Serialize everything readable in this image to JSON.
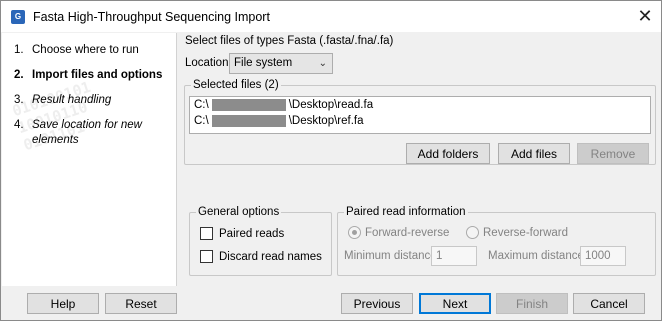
{
  "window": {
    "title": "Fasta High-Throughput Sequencing Import",
    "icon": "clc-app-icon",
    "icon_text": "G"
  },
  "sidebar": {
    "steps": [
      {
        "num": "1.",
        "label": "Choose where to run"
      },
      {
        "num": "2.",
        "label": "Import files and options"
      },
      {
        "num": "3.",
        "label": "Result handling"
      },
      {
        "num": "4.",
        "label": "Save location for new elements"
      }
    ],
    "active_step": 2
  },
  "main": {
    "file_types_text": "Select files of types Fasta (.fasta/.fna/.fa)",
    "location_label": "Location",
    "location_value": "File system",
    "selected_files": {
      "title": "Selected files (2)",
      "files": [
        {
          "prefix": "C:\\",
          "suffix": "\\Desktop\\read.fa"
        },
        {
          "prefix": "C:\\",
          "suffix": "\\Desktop\\ref.fa"
        }
      ],
      "add_folders_label": "Add folders",
      "add_files_label": "Add files",
      "remove_label": "Remove"
    },
    "general_options": {
      "title": "General options",
      "paired_reads_label": "Paired reads",
      "discard_names_label": "Discard read names"
    },
    "paired_info": {
      "title": "Paired read information",
      "forward_reverse_label": "Forward-reverse",
      "reverse_forward_label": "Reverse-forward",
      "min_distance_label": "Minimum distance",
      "min_distance_value": "1",
      "max_distance_label": "Maximum distance",
      "max_distance_value": "1000"
    }
  },
  "footer": {
    "help_label": "Help",
    "reset_label": "Reset",
    "previous_label": "Previous",
    "next_label": "Next",
    "finish_label": "Finish",
    "cancel_label": "Cancel"
  },
  "colors": {
    "accent": "#0078d7",
    "window_bg": "#f0f0f0",
    "disabled_text": "#838383"
  }
}
